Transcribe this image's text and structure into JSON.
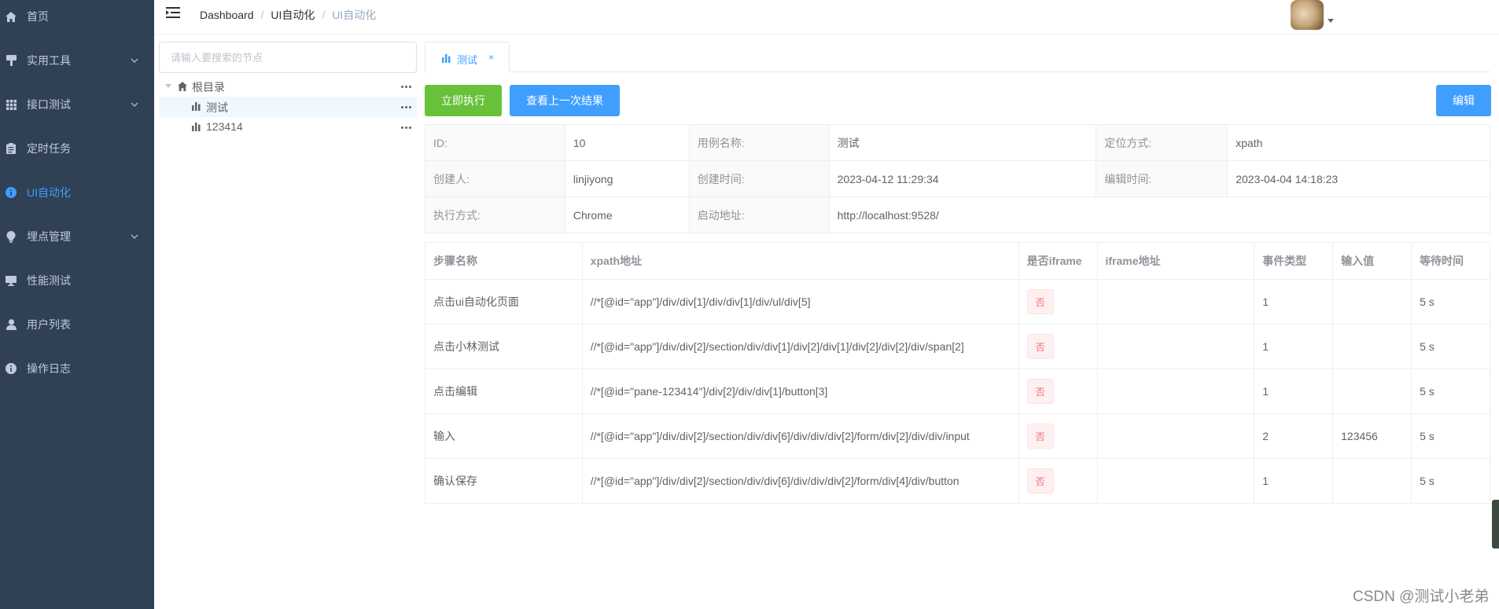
{
  "sidebar": {
    "items": [
      {
        "label": "首页",
        "icon": "home-icon",
        "has_arrow": false,
        "active": false
      },
      {
        "label": "实用工具",
        "icon": "tools-icon",
        "has_arrow": true,
        "active": false
      },
      {
        "label": "接口测试",
        "icon": "grid-icon",
        "has_arrow": true,
        "active": false
      },
      {
        "label": "定时任务",
        "icon": "clipboard-icon",
        "has_arrow": false,
        "active": false
      },
      {
        "label": "UI自动化",
        "icon": "info-circle-icon",
        "has_arrow": false,
        "active": true
      },
      {
        "label": "埋点管理",
        "icon": "bulb-icon",
        "has_arrow": true,
        "active": false
      },
      {
        "label": "性能测试",
        "icon": "monitor-icon",
        "has_arrow": false,
        "active": false
      },
      {
        "label": "用户列表",
        "icon": "user-icon",
        "has_arrow": false,
        "active": false
      },
      {
        "label": "操作日志",
        "icon": "info-circle-icon",
        "has_arrow": false,
        "active": false
      }
    ],
    "active_color": "#409eff"
  },
  "header": {
    "breadcrumb": [
      "Dashboard",
      "UI自动化",
      "UI自动化"
    ],
    "separator": "/"
  },
  "tree": {
    "search_placeholder": "请输入要搜索的节点",
    "root_label": "根目录",
    "children": [
      {
        "label": "测试",
        "current": true
      },
      {
        "label": "123414",
        "current": false
      }
    ]
  },
  "tabs": [
    {
      "label": "测试",
      "close": "×"
    }
  ],
  "toolbar": {
    "run_label": "立即执行",
    "last_result_label": "查看上一次结果",
    "edit_label": "编辑"
  },
  "info": {
    "id_label": "ID:",
    "id_value": "10",
    "case_name_label": "用例名称:",
    "case_name_value": "测试",
    "locate_label": "定位方式:",
    "locate_value": "xpath",
    "creator_label": "创建人:",
    "creator_value": "linjiyong",
    "create_time_label": "创建时间:",
    "create_time_value": "2023-04-12 11:29:34",
    "edit_time_label": "编辑时间:",
    "edit_time_value": "2023-04-04 14:18:23",
    "exec_label": "执行方式:",
    "exec_value": "Chrome",
    "start_url_label": "启动地址:",
    "start_url_value": "http://localhost:9528/"
  },
  "steps": {
    "columns": [
      "步骤名称",
      "xpath地址",
      "是否iframe",
      "iframe地址",
      "事件类型",
      "输入值",
      "等待时间"
    ],
    "rows": [
      {
        "name": "点击ui自动化页面",
        "xpath": "//*[@id=\"app\"]/div/div[1]/div/div[1]/div/ul/div[5]",
        "iframe": "否",
        "iframe_url": "",
        "event": "1",
        "input": "",
        "wait": "5 s"
      },
      {
        "name": "点击小林测试",
        "xpath": "//*[@id=\"app\"]/div/div[2]/section/div/div[1]/div[2]/div[1]/div[2]/div[2]/div/span[2]",
        "iframe": "否",
        "iframe_url": "",
        "event": "1",
        "input": "",
        "wait": "5 s"
      },
      {
        "name": "点击编辑",
        "xpath": "//*[@id=\"pane-123414\"]/div[2]/div/div[1]/button[3]",
        "iframe": "否",
        "iframe_url": "",
        "event": "1",
        "input": "",
        "wait": "5 s"
      },
      {
        "name": "输入",
        "xpath": "//*[@id=\"app\"]/div/div[2]/section/div/div[6]/div/div/div[2]/form/div[2]/div/div/input",
        "iframe": "否",
        "iframe_url": "",
        "event": "2",
        "input": "123456",
        "wait": "5 s"
      },
      {
        "name": "确认保存",
        "xpath": "//*[@id=\"app\"]/div/div[2]/section/div/div[6]/div/div/div[2]/form/div[4]/div/button",
        "iframe": "否",
        "iframe_url": "",
        "event": "1",
        "input": "",
        "wait": "5 s"
      }
    ]
  },
  "watermark": "CSDN @测试小老弟",
  "colors": {
    "sidebar_bg": "#304156",
    "sidebar_text": "#bfcbd9",
    "primary": "#409eff",
    "success": "#67c23a",
    "danger": "#f56c6c"
  }
}
